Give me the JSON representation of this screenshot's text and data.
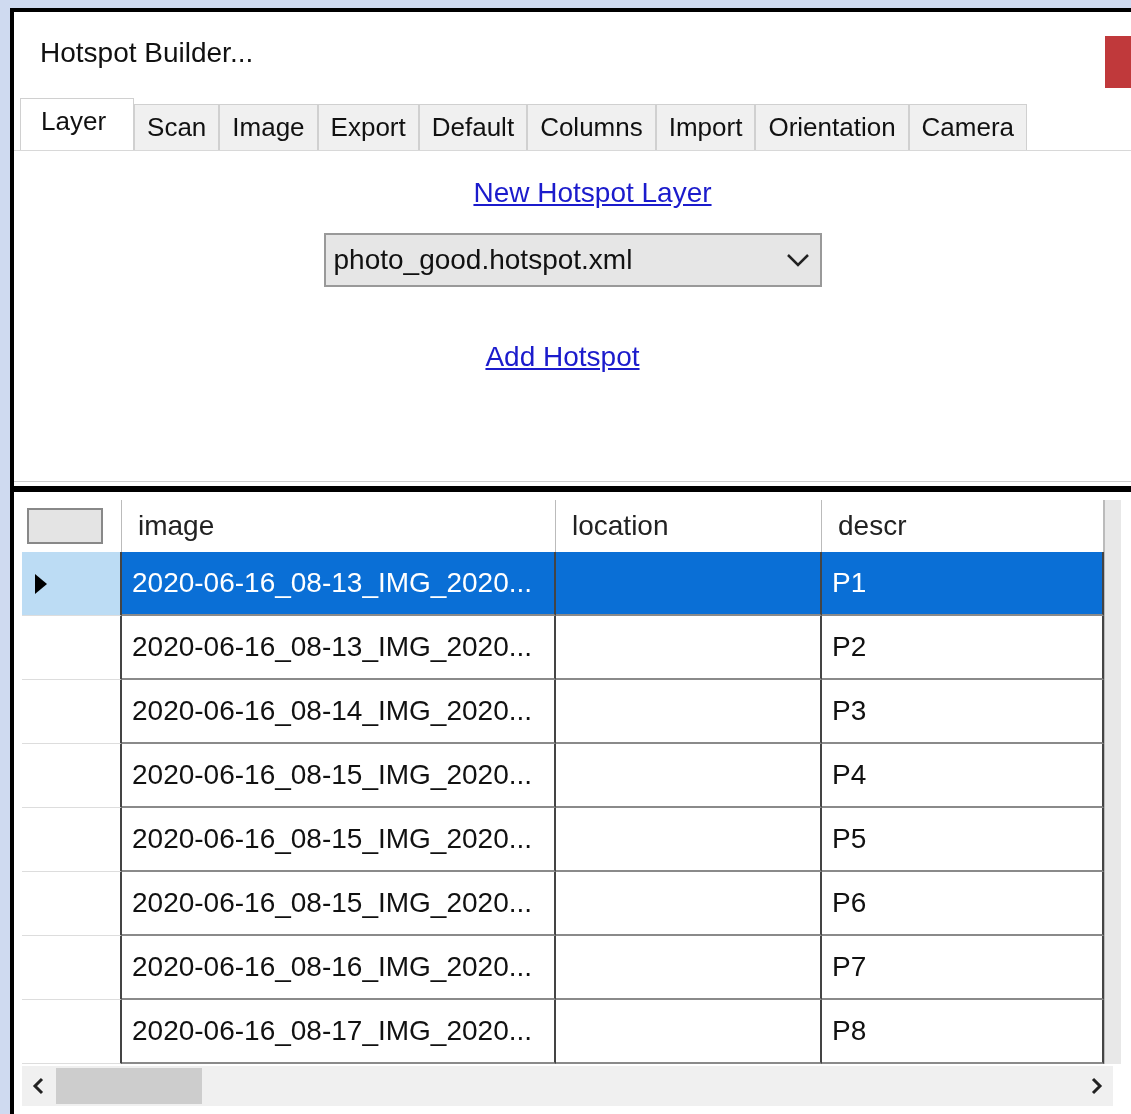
{
  "window": {
    "title": "Hotspot Builder..."
  },
  "tabs": [
    {
      "label": "Layer",
      "selected": true
    },
    {
      "label": "Scan",
      "selected": false
    },
    {
      "label": "Image",
      "selected": false
    },
    {
      "label": "Export",
      "selected": false
    },
    {
      "label": "Default",
      "selected": false
    },
    {
      "label": "Columns",
      "selected": false
    },
    {
      "label": "Import",
      "selected": false
    },
    {
      "label": "Orientation",
      "selected": false
    },
    {
      "label": "Camera",
      "selected": false
    }
  ],
  "layer_panel": {
    "new_layer_link": "New Hotspot Layer",
    "layer_dropdown": {
      "value": "photo_good.hotspot.xml"
    },
    "add_hotspot_link": "Add Hotspot"
  },
  "table": {
    "columns": [
      "image",
      "location",
      "descr"
    ],
    "rows": [
      {
        "image": "2020-06-16_08-13_IMG_2020...",
        "location": "",
        "descr": "P1",
        "selected": true
      },
      {
        "image": "2020-06-16_08-13_IMG_2020...",
        "location": "",
        "descr": "P2",
        "selected": false
      },
      {
        "image": "2020-06-16_08-14_IMG_2020...",
        "location": "",
        "descr": "P3",
        "selected": false
      },
      {
        "image": "2020-06-16_08-15_IMG_2020...",
        "location": "",
        "descr": "P4",
        "selected": false
      },
      {
        "image": "2020-06-16_08-15_IMG_2020...",
        "location": "",
        "descr": "P5",
        "selected": false
      },
      {
        "image": "2020-06-16_08-15_IMG_2020...",
        "location": "",
        "descr": "P6",
        "selected": false
      },
      {
        "image": "2020-06-16_08-16_IMG_2020...",
        "location": "",
        "descr": "P7",
        "selected": false
      },
      {
        "image": "2020-06-16_08-17_IMG_2020...",
        "location": "",
        "descr": "P8",
        "selected": false
      }
    ]
  }
}
